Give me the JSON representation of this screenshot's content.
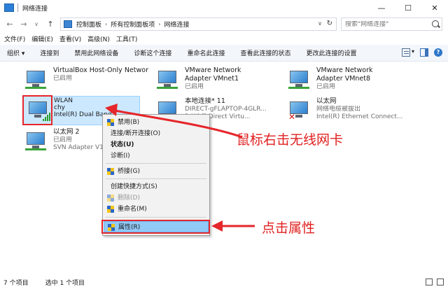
{
  "window": {
    "title": "网络连接",
    "min_glyph": "—",
    "max_glyph": "☐",
    "close_glyph": "✕"
  },
  "nav": {
    "back": "←",
    "forward": "→",
    "recent": "∨",
    "up": "↑"
  },
  "breadcrumb": {
    "items": [
      "控制面板",
      "所有控制面板项",
      "网络连接"
    ],
    "separator": "›",
    "dropdown": "∨",
    "refresh": "↻"
  },
  "search": {
    "placeholder": "搜索\"网络连接\""
  },
  "menubar": {
    "items": [
      "文件(F)",
      "编辑(E)",
      "查看(V)",
      "高级(N)",
      "工具(T)"
    ]
  },
  "toolbar": {
    "organize": "组织 ▾",
    "connect_to": "连接到",
    "disable": "禁用此网络设备",
    "diagnose": "诊断这个连接",
    "rename": "重命名此连接",
    "view_status": "查看此连接的状态",
    "change_settings": "更改此连接的设置",
    "view_dd": "▾",
    "help": "?"
  },
  "connections": [
    {
      "name": "VirtualBox Host-Only Network #2",
      "line2": "",
      "line3": "已启用"
    },
    {
      "name": "VMware Network Adapter VMnet1",
      "line2": "",
      "line3": "已启用"
    },
    {
      "name": "VMware Network Adapter VMnet8",
      "line2": "",
      "line3": "已启用"
    },
    {
      "name": "WLAN",
      "line2": "chy",
      "line3": "Intel(R) Dual Band"
    },
    {
      "name": "本地连接* 11",
      "line2": "DIRECT-gFLAPTOP-4GLR...",
      "line3": "ft Wi-Fi Direct Virtu..."
    },
    {
      "name": "以太网",
      "line2": "网络电缆被拔出",
      "line3": "Intel(R) Ethernet Connect..."
    },
    {
      "name": "以太网 2",
      "line2": "已启用",
      "line3": "SVN Adapter V1"
    }
  ],
  "context_menu": {
    "disable": "禁用(B)",
    "connect": "连接/断开连接(O)",
    "status": "状态(U)",
    "diagnose": "诊断(I)",
    "bridge": "桥接(G)",
    "shortcut": "创建快捷方式(S)",
    "delete": "删除(D)",
    "rename": "重命名(M)",
    "properties": "属性(R)"
  },
  "annotations": {
    "right_click": "鼠标右击无线网卡",
    "click_props": "点击属性"
  },
  "colors": {
    "annotation_red": "#e5262a",
    "selection": "#cce8ff",
    "menu_hover": "#91c9f7"
  },
  "statusbar": {
    "count": "7 个项目",
    "selected": "选中 1 个项目"
  }
}
